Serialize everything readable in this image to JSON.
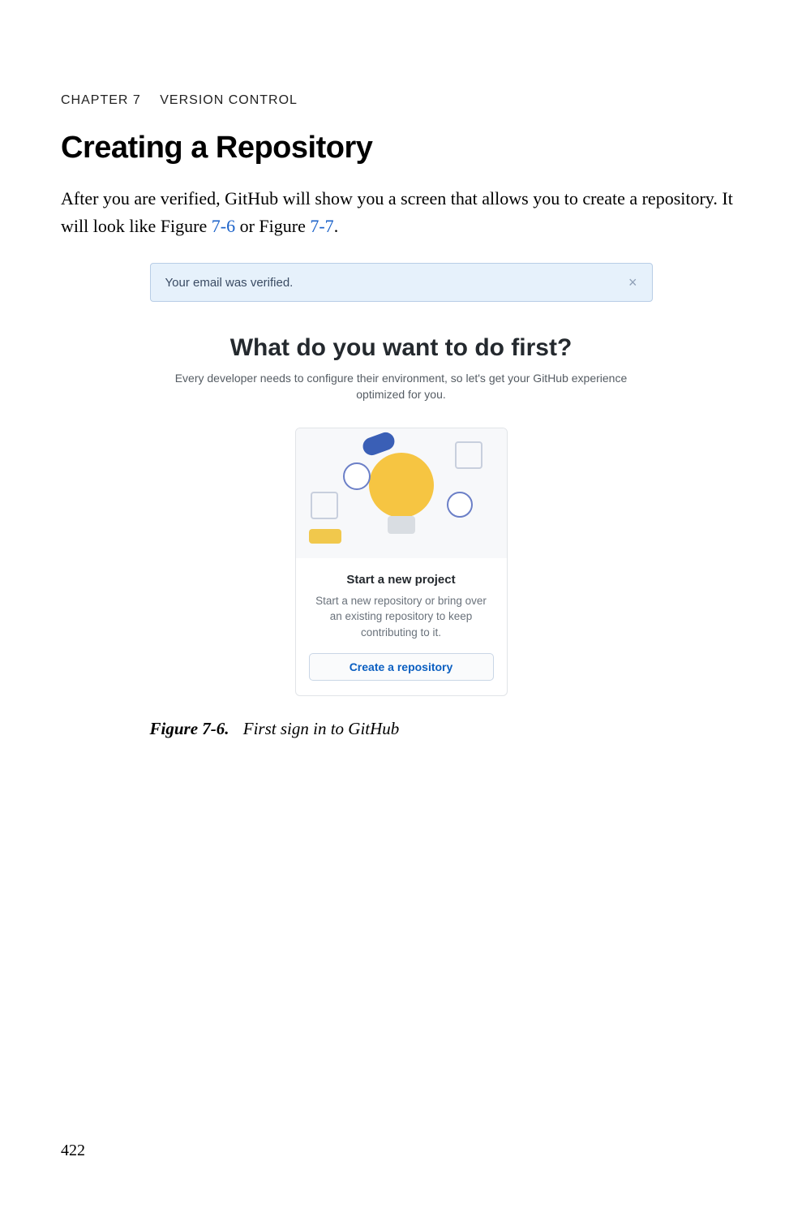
{
  "running_head": {
    "chapter_label": "CHAPTER 7",
    "chapter_title": "VERSION CONTROL"
  },
  "section_title": "Creating a Repository",
  "body_leadin": "After you are verified, GitHub will show you a screen that allows you to create a repository. It will look like Figure ",
  "ref_76": "7-6",
  "body_mid": " or Figure ",
  "ref_77": "7-7",
  "body_end": ".",
  "screenshot": {
    "flash_message": "Your email was verified.",
    "close_glyph": "×",
    "prompt_title": "What do you want to do first?",
    "prompt_subtitle": "Every developer needs to configure their environment, so let's get your GitHub experience optimized for you.",
    "card": {
      "title": "Start a new project",
      "description": "Start a new repository or bring over an existing repository to keep contributing to it.",
      "button_label": "Create a repository"
    }
  },
  "figure_caption": {
    "label": "Figure 7-6.",
    "text": "First sign in to GitHub"
  },
  "page_number": "422"
}
